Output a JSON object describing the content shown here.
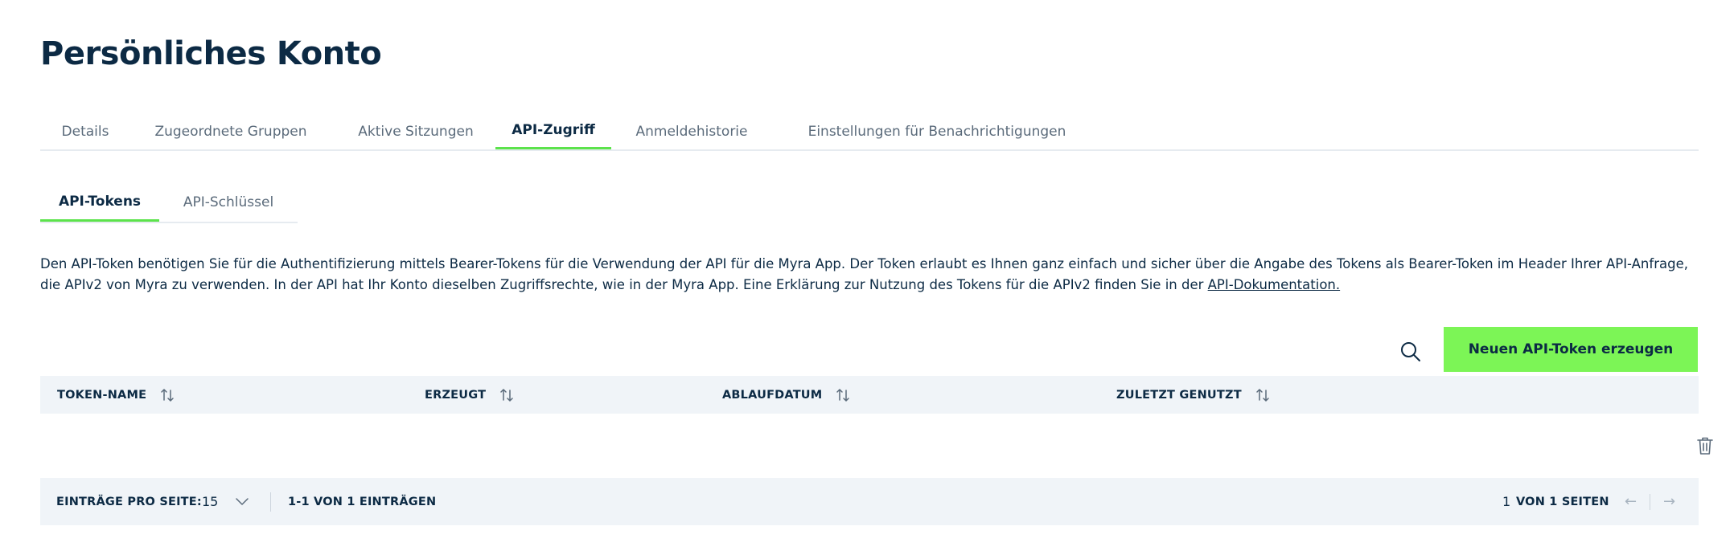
{
  "page": {
    "title": "Persönliches Konto"
  },
  "main_tabs": [
    {
      "label": "Details",
      "active": false
    },
    {
      "label": "Zugeordnete Gruppen",
      "active": false
    },
    {
      "label": "Aktive Sitzungen",
      "active": false
    },
    {
      "label": "API-Zugriff",
      "active": true
    },
    {
      "label": "Anmeldehistorie",
      "active": false
    },
    {
      "label": "Einstellungen für Benachrichtigungen",
      "active": false
    }
  ],
  "sub_tabs": [
    {
      "label": "API-Tokens",
      "active": true
    },
    {
      "label": "API-Schlüssel",
      "active": false
    }
  ],
  "description": {
    "text": "Den API-Token benötigen Sie für die Authentifizierung mittels Bearer-Tokens für die Verwendung der API für die Myra App. Der Token erlaubt es Ihnen ganz einfach und sicher über die Angabe des Tokens als Bearer-Token im Header Ihrer API-Anfrage, die APIv2 von Myra zu verwenden. In der API hat Ihr Konto dieselben Zugriffsrechte, wie in der Myra App. Eine Erklärung zur Nutzung des Tokens für die APIv2 finden Sie in der ",
    "link_label": "API-Dokumentation."
  },
  "toolbar": {
    "search_icon": "search-icon",
    "create_label": "Neuen API-Token erzeugen"
  },
  "table": {
    "columns": [
      "TOKEN-NAME",
      "ERZEUGT",
      "ABLAUFDATUM",
      "ZULETZT GENUTZT"
    ],
    "rows": [
      {
        "token_name": "",
        "created": "",
        "expires": "",
        "last_used": ""
      }
    ]
  },
  "pagination": {
    "per_page_label": "EINTRÄGE PRO SEITE:",
    "per_page_value": "15",
    "entries_info": "1-1 VON 1 EINTRÄGEN",
    "current_page": "1",
    "total_pages_label": "VON 1 SEITEN",
    "prev_symbol": "←",
    "next_symbol": "→"
  },
  "colors": {
    "primary_text": "#0c2a44",
    "accent_green": "#7cf556",
    "tab_underline": "#5ce34b",
    "table_bg": "#f0f4f8"
  }
}
